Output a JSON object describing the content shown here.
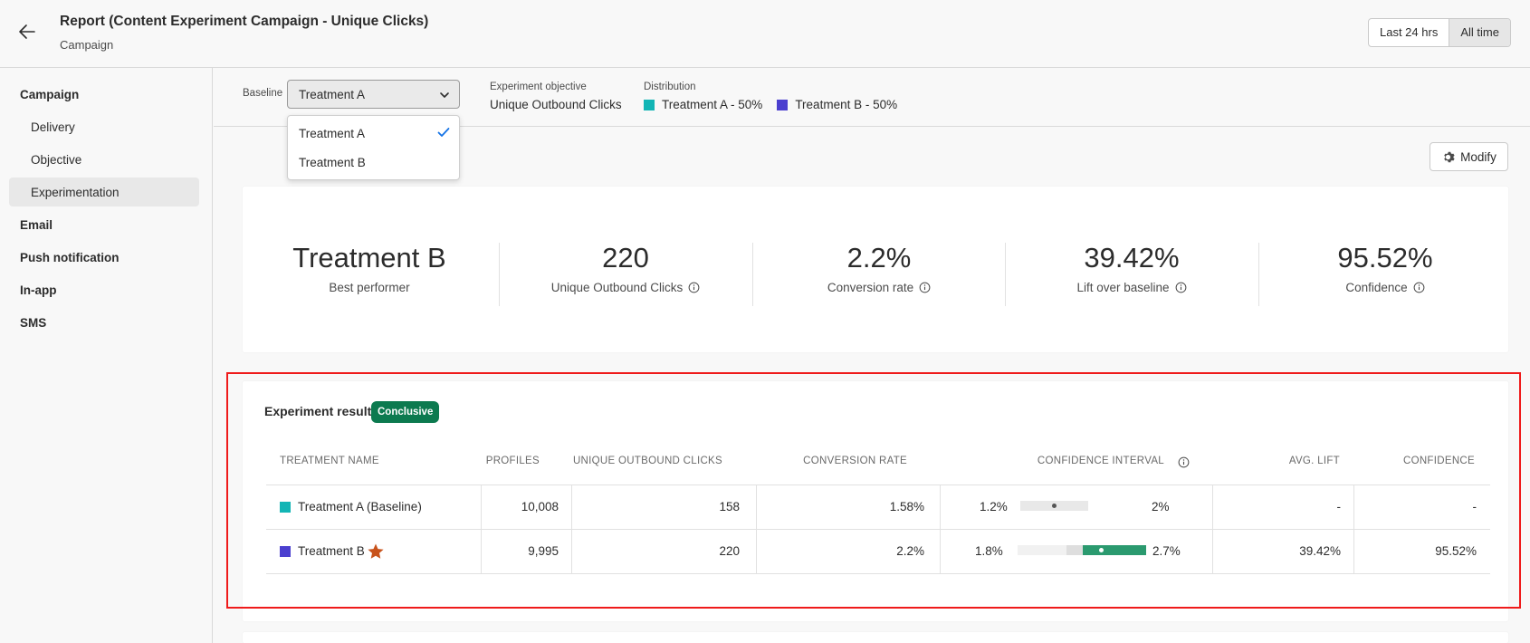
{
  "header": {
    "title": "Report (Content Experiment Campaign - Unique Clicks)",
    "subtitle": "Campaign",
    "range_options": [
      "Last 24 hrs",
      "All time"
    ],
    "range_selected": "All time"
  },
  "sidebar": {
    "items": [
      {
        "label": "Campaign",
        "kind": "group"
      },
      {
        "label": "Delivery",
        "kind": "sub"
      },
      {
        "label": "Objective",
        "kind": "sub"
      },
      {
        "label": "Experimentation",
        "kind": "sub",
        "selected": true
      },
      {
        "label": "Email",
        "kind": "group"
      },
      {
        "label": "Push notification",
        "kind": "group"
      },
      {
        "label": "In-app",
        "kind": "group"
      },
      {
        "label": "SMS",
        "kind": "group"
      }
    ]
  },
  "filters": {
    "baseline_label": "Baseline",
    "baseline_value": "Treatment A",
    "objective_label": "Experiment objective",
    "objective_value": "Unique Outbound Clicks",
    "distribution_label": "Distribution",
    "distribution": [
      {
        "label": "Treatment A - 50%",
        "color": "#12b5b5"
      },
      {
        "label": "Treatment B - 50%",
        "color": "#4b3fcf"
      }
    ]
  },
  "dropdown": {
    "options": [
      "Treatment A",
      "Treatment B"
    ],
    "selected": "Treatment A",
    "check_color": "#1473e6"
  },
  "modify_label": "Modify",
  "summary": {
    "stats": [
      {
        "value": "Treatment B",
        "label": "Best performer",
        "info": false
      },
      {
        "value": "220",
        "label": "Unique Outbound Clicks",
        "info": true
      },
      {
        "value": "2.2%",
        "label": "Conversion rate",
        "info": true
      },
      {
        "value": "39.42%",
        "label": "Lift over baseline",
        "info": true
      },
      {
        "value": "95.52%",
        "label": "Confidence",
        "info": true
      }
    ]
  },
  "results": {
    "title": "Experiment results",
    "badge": "Conclusive",
    "badge_color": "#0c7a4f",
    "columns": [
      "TREATMENT NAME",
      "PROFILES",
      "UNIQUE OUTBOUND CLICKS",
      "CONVERSION RATE",
      "CONFIDENCE INTERVAL",
      "AVG. LIFT",
      "CONFIDENCE"
    ],
    "rows": [
      {
        "name": "Treatment A (Baseline)",
        "color": "#12b5b5",
        "profiles": "10,008",
        "clicks": "158",
        "conversion": "1.58%",
        "ci_low": "1.2%",
        "ci_high": "2%",
        "avg_lift": "-",
        "confidence": "-",
        "star": false
      },
      {
        "name": "Treatment B",
        "color": "#4b3fcf",
        "profiles": "9,995",
        "clicks": "220",
        "conversion": "2.2%",
        "ci_low": "1.8%",
        "ci_high": "2.7%",
        "avg_lift": "39.42%",
        "confidence": "95.52%",
        "star": true
      }
    ],
    "ci_fill_color": "#2b9a6f",
    "star_color": "#c8531c"
  },
  "highlight_color": "#ef1b1b"
}
